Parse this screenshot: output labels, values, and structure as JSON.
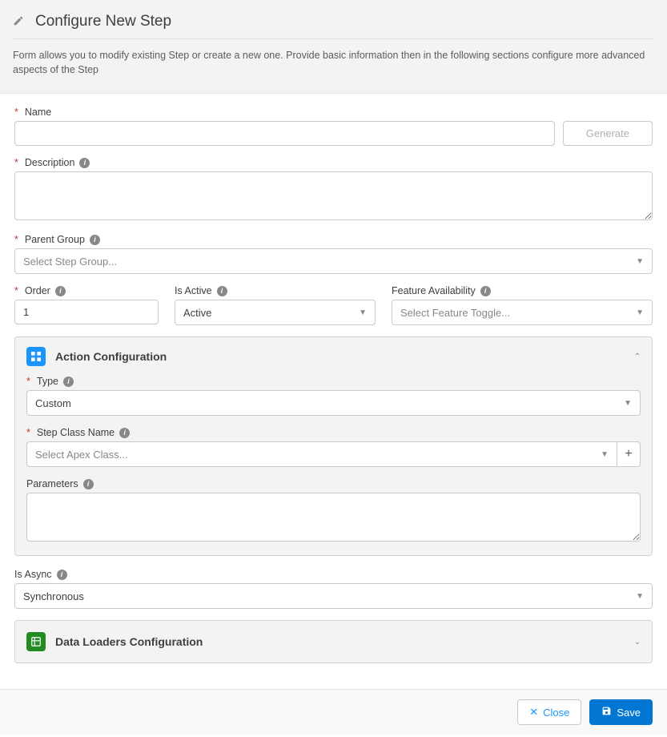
{
  "header": {
    "title": "Configure New Step",
    "subtitle": "Form allows you to modify existing Step or create a new one. Provide basic information then in the following sections configure more advanced aspects of the Step"
  },
  "name": {
    "label": "Name",
    "value": "",
    "generate_label": "Generate"
  },
  "description": {
    "label": "Description",
    "value": ""
  },
  "parent_group": {
    "label": "Parent Group",
    "placeholder": "Select Step Group..."
  },
  "order": {
    "label": "Order",
    "value": "1"
  },
  "is_active": {
    "label": "Is Active",
    "value": "Active"
  },
  "feature_avail": {
    "label": "Feature Availability",
    "placeholder": "Select Feature Toggle..."
  },
  "action_config": {
    "title": "Action Configuration",
    "type": {
      "label": "Type",
      "value": "Custom"
    },
    "step_class": {
      "label": "Step Class Name",
      "placeholder": "Select Apex Class..."
    },
    "parameters": {
      "label": "Parameters",
      "value": ""
    }
  },
  "is_async": {
    "label": "Is Async",
    "value": "Synchronous"
  },
  "data_loaders": {
    "title": "Data Loaders Configuration"
  },
  "footer": {
    "close": "Close",
    "save": "Save"
  }
}
